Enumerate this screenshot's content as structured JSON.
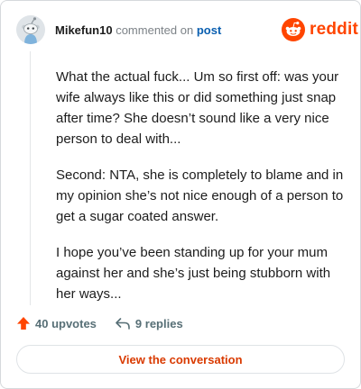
{
  "header": {
    "username": "Mikefun10",
    "action": "commented on",
    "post_link": "post",
    "brand": "reddit"
  },
  "comment": {
    "paragraphs": [
      "What the actual fuck... Um so first off: was your wife always like this or did something just snap after time? She doesn’t sound like a very nice person to deal with...",
      "Second: NTA, she is completely to blame and in my opinion she’s not nice enough of a person to get a sugar coated answer.",
      "I hope you’ve been standing up for your mum against her and she’s just being stubborn with her ways..."
    ]
  },
  "footer": {
    "upvotes": "40 upvotes",
    "replies": "9 replies"
  },
  "cta": {
    "label": "View the conversation"
  },
  "colors": {
    "brand": "#ff4500",
    "link": "#0a5fb0",
    "cta_text": "#d93a00",
    "muted": "#576f76"
  },
  "icons": {
    "avatar": "snoo-avatar",
    "logo": "reddit-snoo-icon",
    "upvote": "upvote-arrow-icon",
    "reply": "reply-arrow-icon"
  }
}
